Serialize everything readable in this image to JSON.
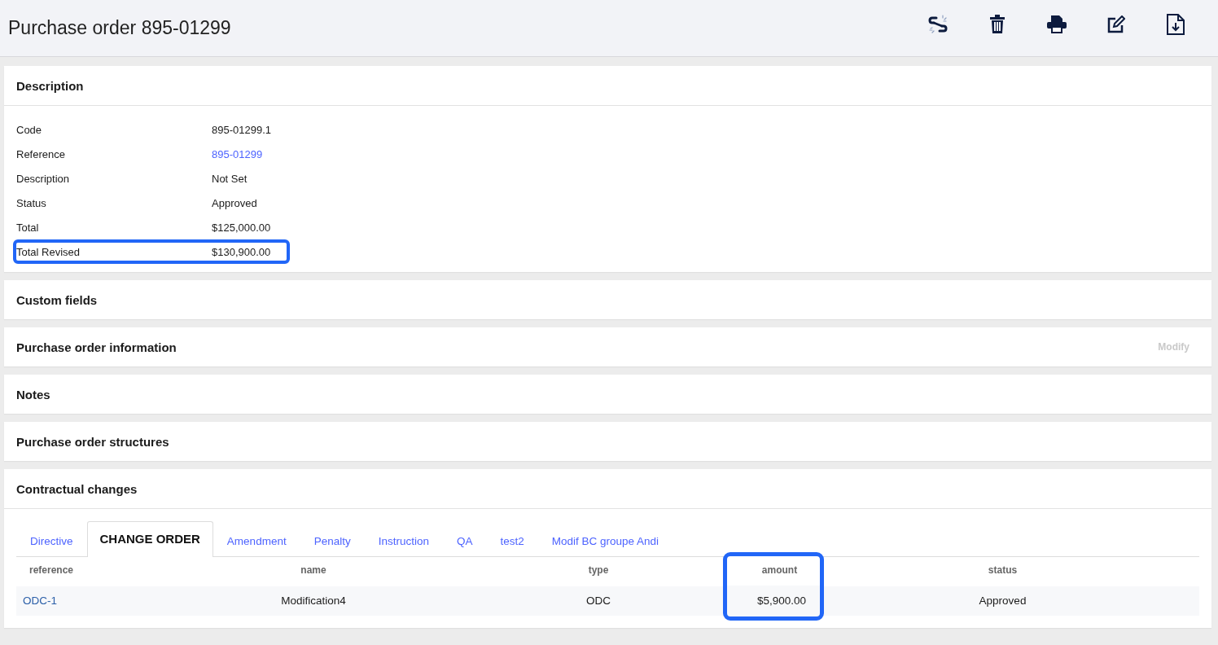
{
  "title": "Purchase order 895-01299",
  "toolbar": [
    {
      "kind": "unlink"
    },
    {
      "kind": "trash"
    },
    {
      "kind": "print"
    },
    {
      "kind": "edit"
    },
    {
      "kind": "download"
    }
  ],
  "description": {
    "title": "Description",
    "fields": [
      {
        "label": "Code",
        "value": "895-01299.1",
        "kind": "text",
        "highlighted": false
      },
      {
        "label": "Reference",
        "value": "895-01299",
        "kind": "link",
        "highlighted": false
      },
      {
        "label": "Description",
        "value": "Not Set",
        "kind": "text",
        "highlighted": false
      },
      {
        "label": "Status",
        "value": "Approved",
        "kind": "text",
        "highlighted": false
      },
      {
        "label": "Total",
        "value": "$125,000.00",
        "kind": "text",
        "highlighted": false
      },
      {
        "label": "Total Revised",
        "value": "$130,900.00",
        "kind": "text",
        "highlighted": true
      }
    ]
  },
  "sections": [
    {
      "title": "Custom fields"
    },
    {
      "title": "Purchase order information",
      "action": {
        "label": "Modify",
        "disabled": true
      }
    },
    {
      "title": "Notes"
    },
    {
      "title": "Purchase order structures"
    }
  ],
  "contractual_changes": {
    "title": "Contractual changes",
    "tabs": [
      {
        "label": "Directive",
        "selected": false
      },
      {
        "label": "CHANGE ORDER",
        "selected": true
      },
      {
        "label": "Amendment",
        "selected": false
      },
      {
        "label": "Penalty",
        "selected": false
      },
      {
        "label": "Instruction",
        "selected": false
      },
      {
        "label": "QA",
        "selected": false
      },
      {
        "label": "test2",
        "selected": false
      },
      {
        "label": "Modif BC groupe Andi",
        "selected": false
      }
    ],
    "table": {
      "columns": [
        {
          "label": "reference",
          "highlighted": false
        },
        {
          "label": "name",
          "highlighted": false
        },
        {
          "label": "type",
          "highlighted": false
        },
        {
          "label": "amount",
          "highlighted": true
        },
        {
          "label": "status",
          "highlighted": false
        }
      ],
      "rows": [
        [
          "ODC-1",
          "Modification4",
          "ODC",
          "$5,900.00",
          "Approved"
        ]
      ]
    }
  }
}
